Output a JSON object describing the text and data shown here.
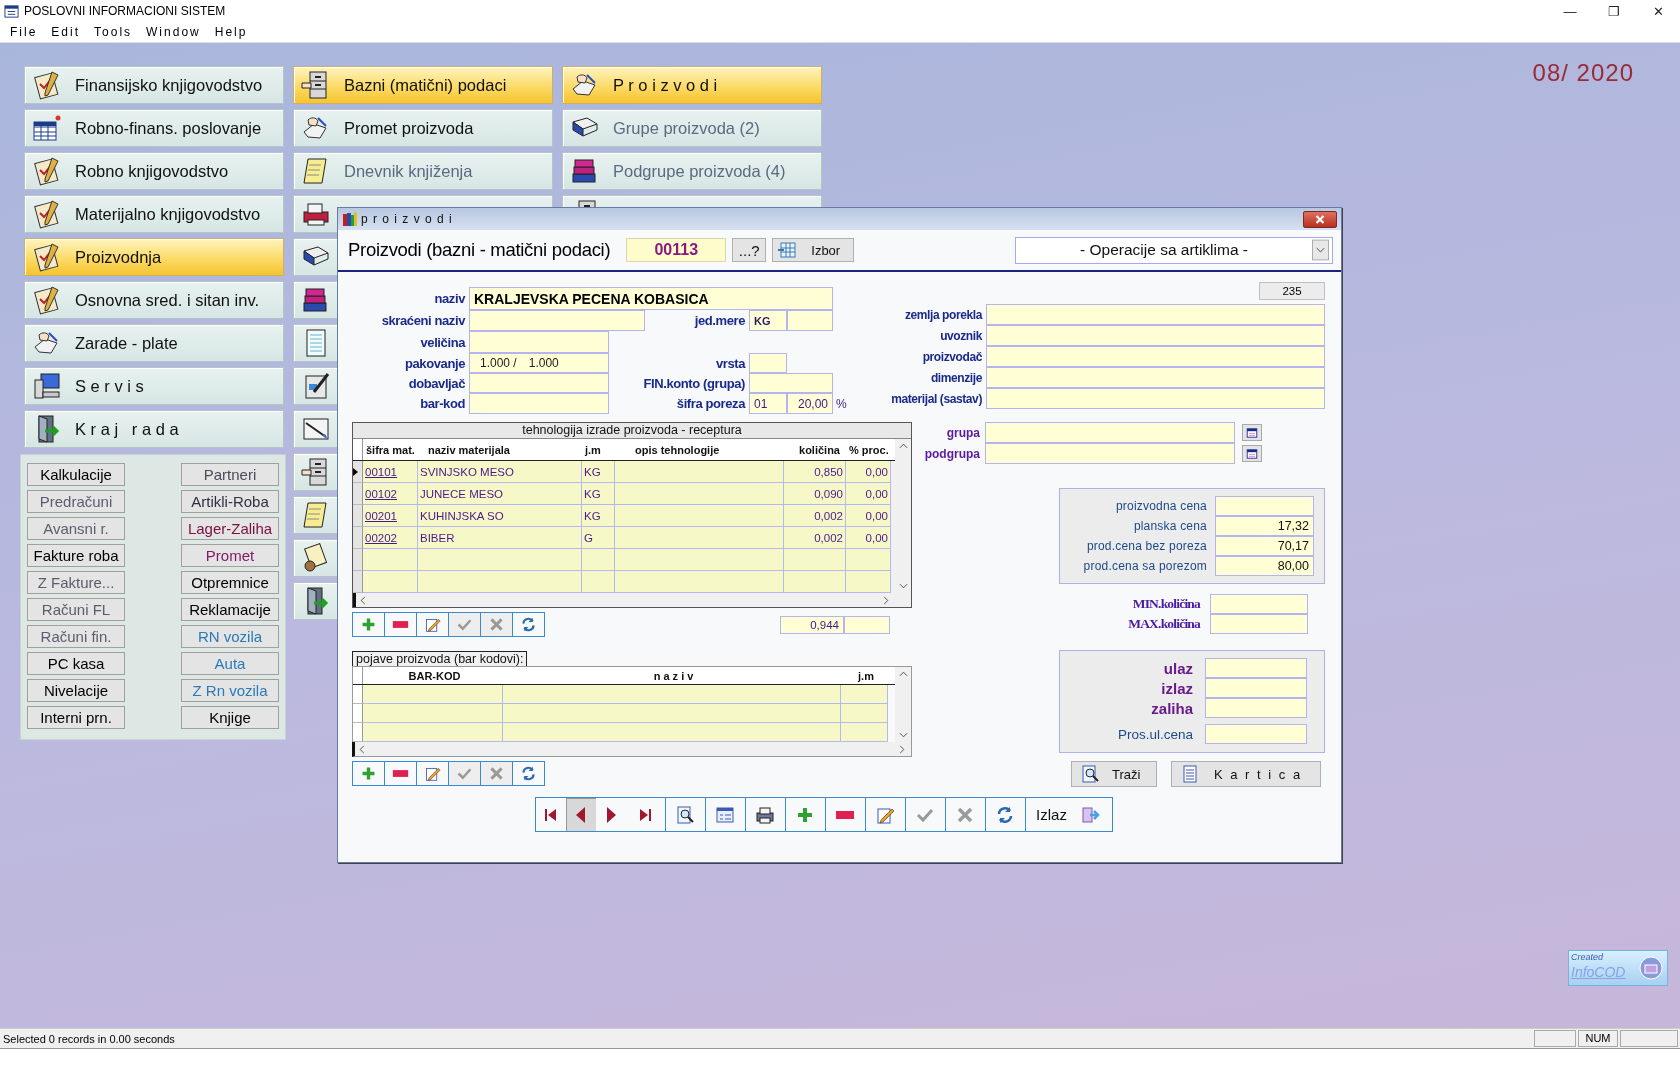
{
  "window": {
    "title": "POSLOVNI INFORMACIONI SISTEM",
    "controls": [
      "—",
      "❐",
      "✕"
    ]
  },
  "menu": [
    "File",
    "Edit",
    "Tools",
    "Window",
    "Help"
  ],
  "period": "08/ 2020",
  "module_columns": [
    [
      {
        "label": "Finansijsko knjigovodstvo",
        "kind": "clipboard",
        "selected": false,
        "dimmed": false
      },
      {
        "label": "Robno-finans. poslovanje",
        "kind": "spreadsheet",
        "selected": false,
        "dimmed": false
      },
      {
        "label": "Robno knjigovodstvo",
        "kind": "clipboard",
        "selected": false,
        "dimmed": false
      },
      {
        "label": "Materijalno knjigovodstvo",
        "kind": "clipboard",
        "selected": false,
        "dimmed": false
      },
      {
        "label": "Proizvodnja",
        "kind": "clipboard",
        "selected": true,
        "dimmed": false
      },
      {
        "label": "Osnovna sred. i sitan inv.",
        "kind": "clipboard",
        "selected": false,
        "dimmed": false
      },
      {
        "label": "Zarade - plate",
        "kind": "hand",
        "selected": false,
        "dimmed": false
      },
      {
        "label": "S e r v i s",
        "kind": "computer",
        "selected": false,
        "dimmed": false
      },
      {
        "label": "K r a j   r a d a",
        "kind": "door",
        "selected": false,
        "dimmed": false
      }
    ],
    [
      {
        "label": "Bazni (matični) podaci",
        "kind": "cabinet",
        "selected": true,
        "dimmed": false
      },
      {
        "label": "Promet proizvoda",
        "kind": "hand",
        "selected": false,
        "dimmed": false
      },
      {
        "label": "Dnevnik knjiženja",
        "kind": "notepad",
        "selected": false,
        "dimmed": true
      },
      {
        "kind": "printer",
        "selected": false
      },
      {
        "kind": "book",
        "selected": false
      },
      {
        "kind": "books",
        "selected": false
      },
      {
        "kind": "sheet",
        "selected": false
      },
      {
        "kind": "pen",
        "selected": false
      },
      {
        "kind": "drawing",
        "selected": false
      },
      {
        "kind": "cabinet",
        "selected": false
      },
      {
        "kind": "notepad",
        "selected": false
      },
      {
        "kind": "cards",
        "selected": false
      },
      {
        "kind": "door",
        "selected": false
      }
    ],
    [
      {
        "label": "P r o i z v o d i",
        "kind": "hand",
        "selected": true,
        "dimmed": false
      },
      {
        "label": "Grupe proizvoda (2)",
        "kind": "book",
        "selected": false,
        "dimmed": true
      },
      {
        "label": "Podgrupe proizvoda (4)",
        "kind": "books",
        "selected": false,
        "dimmed": true
      },
      {
        "kind": "cabinet",
        "selected": false
      }
    ]
  ],
  "quick_buttons": [
    [
      {
        "label": "Kalkulacije",
        "color": "#000000"
      },
      {
        "label": "Predračuni",
        "color": "#5c5c70"
      },
      {
        "label": "Avansni r.",
        "color": "#5c5c70"
      },
      {
        "label": "Fakture roba",
        "color": "#000000"
      },
      {
        "label": "Z Fakture...",
        "color": "#5c5c70"
      },
      {
        "label": "Računi FL",
        "color": "#5c5c70"
      },
      {
        "label": "Računi fin.",
        "color": "#5c5c70"
      },
      {
        "label": "PC kasa",
        "color": "#000000"
      },
      {
        "label": "Nivelacije",
        "color": "#000000"
      },
      {
        "label": "Interni prn.",
        "color": "#000000"
      }
    ],
    [
      {
        "label": "Partneri",
        "color": "#4a4a5c"
      },
      {
        "label": "Artikli-Roba",
        "color": "#303040"
      },
      {
        "label": "Lager-Zaliha",
        "color": "#7a1040"
      },
      {
        "label": "Promet",
        "color": "#801a6a"
      },
      {
        "label": "Otpremnice",
        "color": "#000000"
      },
      {
        "label": "Reklamacije",
        "color": "#000000"
      },
      {
        "label": "RN vozila",
        "color": "#2a7ab8"
      },
      {
        "label": "Auta",
        "color": "#2a7ab8"
      },
      {
        "label": "Z Rn vozila",
        "color": "#2a7ab8"
      },
      {
        "label": "Knjige",
        "color": "#000000"
      }
    ]
  ],
  "dialog": {
    "title": "p r o i z v o d i",
    "heading": "Proizvodi (bazni - matični podaci)",
    "code": "00113",
    "lookup_button": "...?",
    "choose_button": "Izbor",
    "operations": "- Operacije sa artiklima -",
    "record_count": "235",
    "fields": {
      "naziv": {
        "label": "naziv",
        "value": "KRALJEVSKA PECENA KOBASICA"
      },
      "skraceni": {
        "label": "skraćeni naziv"
      },
      "jed_mere": {
        "label": "jed.mere",
        "value": "KG"
      },
      "velicina": {
        "label": "veličina"
      },
      "pakovanje": {
        "label": "pakovanje",
        "value": "1.000 /",
        "value_2": "1.000"
      },
      "vrsta": {
        "label": "vrsta"
      },
      "dobavljac": {
        "label": "dobavljač"
      },
      "fin_konto": {
        "label": "FIN.konto (grupa)"
      },
      "bar_kod": {
        "label": "bar-kod"
      },
      "sifra_poreza": {
        "label": "šifra poreza",
        "value": "01",
        "value_2": "20,00",
        "unit": "%"
      }
    },
    "origin_fields": [
      {
        "label": "zemlja porekla"
      },
      {
        "label": "uvoznik"
      },
      {
        "label": "proizvodač"
      },
      {
        "label": "dimenzije"
      },
      {
        "label": "materijal (sastav)"
      }
    ],
    "group_fields": [
      {
        "label": "grupa"
      },
      {
        "label": "podgrupa"
      }
    ],
    "recipe": {
      "caption": "tehnologija izrade proizvoda - receptura",
      "columns": [
        "šifra mat.",
        "naziv materijala",
        "j.m",
        "opis tehnologije",
        "količina",
        "% proc."
      ],
      "rows": [
        {
          "code": "00101",
          "material": "SVINJSKO MESO",
          "unit": "KG",
          "quantity": "0,850",
          "loss": "0,00",
          "current": true
        },
        {
          "code": "00102",
          "material": "JUNECE MESO",
          "unit": "KG",
          "quantity": "0,090",
          "loss": "0,00",
          "current": false
        },
        {
          "code": "00201",
          "material": "KUHINJSKA SO",
          "unit": "KG",
          "quantity": "0,002",
          "loss": "0,00",
          "current": false
        },
        {
          "code": "00202",
          "material": "BIBER",
          "unit": "G",
          "quantity": "0,002",
          "loss": "0,00",
          "current": false
        }
      ],
      "total": "0,944"
    },
    "recipe_tools": [
      {
        "kind": "add",
        "disabled": false
      },
      {
        "kind": "remove",
        "disabled": false
      },
      {
        "kind": "edit",
        "disabled": false
      },
      {
        "kind": "confirm",
        "disabled": true
      },
      {
        "kind": "cancel",
        "disabled": true
      },
      {
        "kind": "refresh",
        "disabled": false
      }
    ],
    "barcodes": {
      "caption": "pojave proizvoda (bar kodovi):",
      "columns": [
        "BAR-KOD",
        "n a z i v",
        "j.m"
      ]
    },
    "barcode_tools": [
      {
        "kind": "add",
        "disabled": false
      },
      {
        "kind": "remove",
        "disabled": false
      },
      {
        "kind": "edit",
        "disabled": false
      },
      {
        "kind": "confirm",
        "disabled": true
      },
      {
        "kind": "cancel",
        "disabled": true
      },
      {
        "kind": "refresh",
        "disabled": false
      }
    ],
    "prices": [
      {
        "label": "proizvodna cena"
      },
      {
        "label": "planska cena",
        "value": "17,32"
      },
      {
        "label": "prod.cena bez poreza",
        "value": "70,17"
      },
      {
        "label": "prod.cena sa porezom",
        "value": "80,00"
      }
    ],
    "limits": [
      {
        "label": "MIN.količina"
      },
      {
        "label": "MAX.količina"
      }
    ],
    "stock": [
      {
        "label": "ulaz"
      },
      {
        "label": "izlaz"
      },
      {
        "label": "zaliha"
      }
    ],
    "avg_price": {
      "label": "Pros.ul.cena"
    },
    "search_button": "Traži",
    "card_button": "K a r t i c a",
    "nav": [
      {
        "kind": "first",
        "pressed": false
      },
      {
        "kind": "prev",
        "pressed": true
      },
      {
        "kind": "next",
        "pressed": false
      },
      {
        "kind": "last",
        "pressed": false
      },
      {
        "kind": "search",
        "pressed": false
      },
      {
        "kind": "form",
        "pressed": false
      },
      {
        "kind": "print",
        "pressed": false
      },
      {
        "kind": "add",
        "pressed": false
      },
      {
        "kind": "remove",
        "pressed": false
      },
      {
        "kind": "edit",
        "pressed": false
      },
      {
        "kind": "confirm",
        "pressed": false
      },
      {
        "kind": "cancel",
        "pressed": false
      },
      {
        "kind": "refresh",
        "pressed": false
      }
    ],
    "exit_button": "Izlaz"
  },
  "logo": {
    "line_1": "Created",
    "line_2": "InfoCOD"
  },
  "status_bar": {
    "message": "Selected 0 records in 0.00 seconds",
    "indicator": "NUM"
  }
}
